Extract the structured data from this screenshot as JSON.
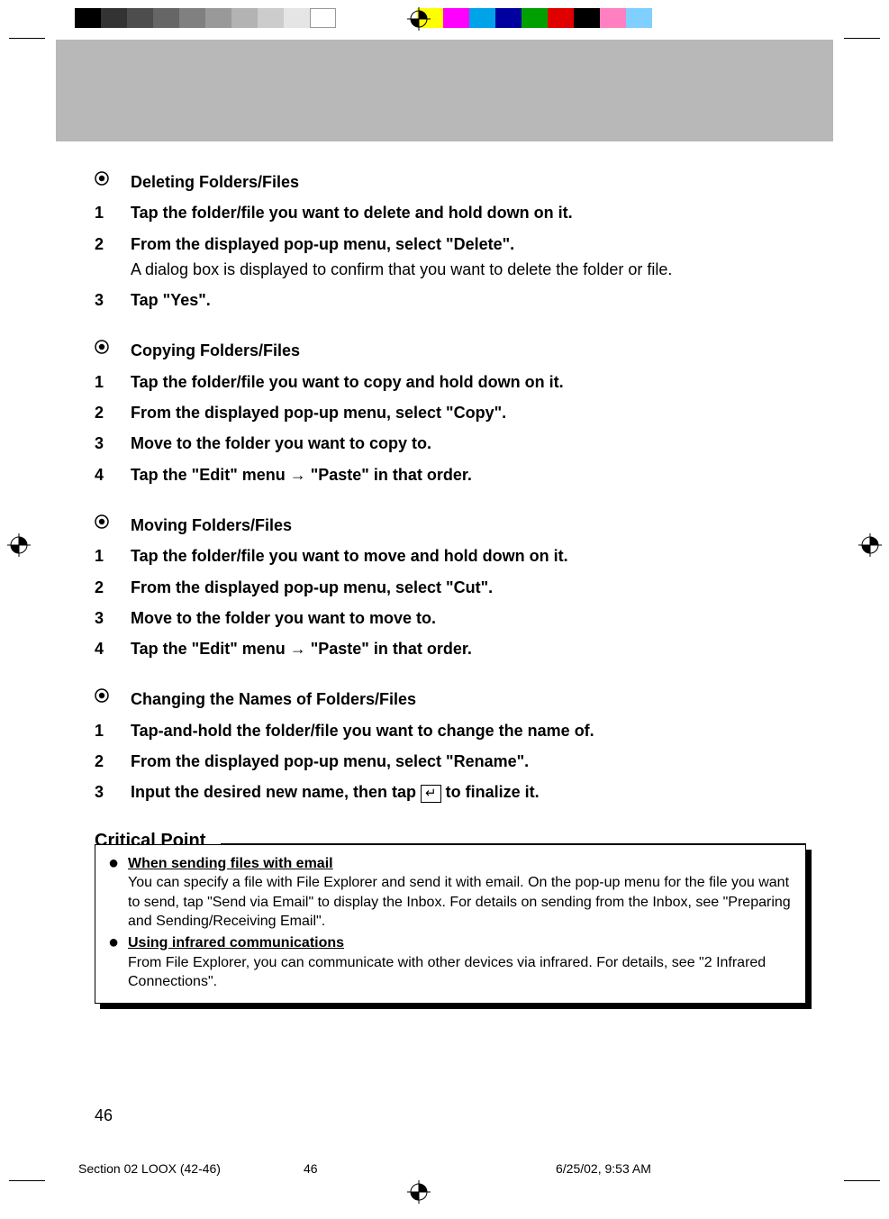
{
  "sections": [
    {
      "heading": "Deleting Folders/Files",
      "steps": [
        {
          "num": "1",
          "text": "Tap the folder/file you want to delete and hold down on it."
        },
        {
          "num": "2",
          "text": "From the displayed pop-up menu, select \"Delete\".",
          "note": "A dialog box is displayed to confirm that you want to delete the folder or file."
        },
        {
          "num": "3",
          "text": "Tap \"Yes\"."
        }
      ]
    },
    {
      "heading": "Copying Folders/Files",
      "steps": [
        {
          "num": "1",
          "text": "Tap the folder/file you want to copy and hold down on it."
        },
        {
          "num": "2",
          "text": "From the displayed pop-up menu, select \"Copy\"."
        },
        {
          "num": "3",
          "text": "Move to the folder you want to copy to."
        },
        {
          "num": "4",
          "text": "Tap the \"Edit\" menu → \"Paste\" in that order."
        }
      ]
    },
    {
      "heading": "Moving Folders/Files",
      "steps": [
        {
          "num": "1",
          "text": "Tap the folder/file you want to move and hold down on it."
        },
        {
          "num": "2",
          "text": "From the displayed pop-up menu, select \"Cut\"."
        },
        {
          "num": "3",
          "text": "Move to the folder you want to move to."
        },
        {
          "num": "4",
          "text": "Tap the \"Edit\" menu → \"Paste\" in that order."
        }
      ]
    },
    {
      "heading": "Changing the Names of Folders/Files",
      "steps": [
        {
          "num": "1",
          "text": "Tap-and-hold the folder/file you want to change the name of."
        },
        {
          "num": "2",
          "text": "From the displayed pop-up menu, select \"Rename\"."
        },
        {
          "num": "3",
          "pre": "Input the desired new name, then tap ",
          "icon": "↵",
          "post": " to finalize it."
        }
      ]
    }
  ],
  "critical_point": {
    "title": "Critical Point",
    "items": [
      {
        "title": "When sending files with email",
        "body": "You can specify a file with File Explorer and send it with email. On the pop-up menu for the file you want to send, tap \"Send via Email\" to display the Inbox. For details on sending from the Inbox, see \"Preparing and Sending/Receiving Email\"."
      },
      {
        "title": "Using infrared communications",
        "body": "From File Explorer, you can communicate with other devices via infrared. For details, see \"2 Infrared Connections\"."
      }
    ]
  },
  "page_number": "46",
  "footer": {
    "doc": "Section 02 LOOX (42-46)",
    "page": "46",
    "datetime": "6/25/02, 9:53 AM"
  },
  "icons": {
    "enter": "↵"
  }
}
